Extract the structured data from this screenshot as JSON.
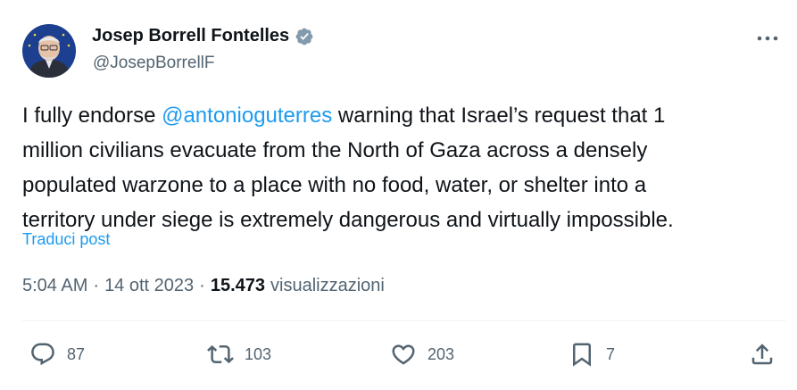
{
  "author": {
    "display_name": "Josep Borrell Fontelles",
    "handle": "@JosepBorrellF",
    "verified_icon": "verified-badge-icon",
    "verified_color": "#829aab"
  },
  "tweet": {
    "lines": [
      [
        {
          "t": "I fully endorse ",
          "m": false
        },
        {
          "t": "@antonioguterres",
          "m": true
        },
        {
          "t": " warning that Israel’s request that 1",
          "m": false
        }
      ],
      [
        {
          "t": "million civilians evacuate from the North of Gaza across a densely",
          "m": false
        }
      ],
      [
        {
          "t": "populated warzone to a place with no food, water, or shelter into a",
          "m": false
        }
      ],
      [
        {
          "t": "territory under siege is extremely dangerous and virtually impossible.",
          "m": false
        }
      ]
    ],
    "translate_label": "Traduci post"
  },
  "meta": {
    "time": "5:04 AM",
    "separator": "·",
    "date": "14 ott 2023",
    "views_count": "15.473",
    "views_label": "visualizzazioni"
  },
  "actions": {
    "reply": {
      "icon": "reply-icon",
      "count": "87"
    },
    "repost": {
      "icon": "repost-icon",
      "count": "103"
    },
    "like": {
      "icon": "heart-icon",
      "count": "203"
    },
    "bookmark": {
      "icon": "bookmark-icon",
      "count": "7"
    },
    "share": {
      "icon": "share-icon"
    }
  },
  "colors": {
    "link": "#1d9bf0",
    "text": "#0f1419",
    "secondary": "#536471"
  }
}
